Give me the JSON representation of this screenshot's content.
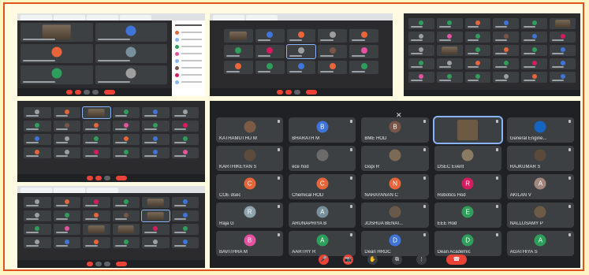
{
  "big_call": {
    "close_glyph": "✕",
    "participants": [
      {
        "label": "KATHAMUTHU M",
        "initial": "",
        "color": "#7b5b43",
        "photo": true
      },
      {
        "label": "BHARATH M",
        "initial": "B",
        "color": "#3f74d8",
        "photo": false
      },
      {
        "label": "BME HOD",
        "initial": "B",
        "color": "#795548",
        "photo": false
      },
      {
        "label": "",
        "initial": "",
        "color": "#6d5a45",
        "photo": true,
        "active": true
      },
      {
        "label": "General Engine...",
        "initial": "",
        "color": "#1565c0",
        "photo": true
      },
      {
        "label": "KARTHIKEYAN S",
        "initial": "",
        "color": "#5d4c3c",
        "photo": true
      },
      {
        "label": "ece hod",
        "initial": "",
        "color": "#6b6b6b",
        "photo": true
      },
      {
        "label": "Gopi R",
        "initial": "",
        "color": "#7c6a55",
        "photo": true
      },
      {
        "label": "DSEC Event",
        "initial": "",
        "color": "#8c7b63",
        "photo": true
      },
      {
        "label": "RAJKUMAR S",
        "initial": "",
        "color": "#5b4a3a",
        "photo": true
      },
      {
        "label": "COE dsec",
        "initial": "C",
        "color": "#e8653a",
        "photo": false
      },
      {
        "label": "Chemical HOD",
        "initial": "C",
        "color": "#e8653a",
        "photo": false
      },
      {
        "label": "NARAYANAN C",
        "initial": "N",
        "color": "#e8653a",
        "photo": false
      },
      {
        "label": "Robotics Hod",
        "initial": "R",
        "color": "#d81b60",
        "photo": false
      },
      {
        "label": "AKILAN V",
        "initial": "A",
        "color": "#a1887f",
        "photo": false
      },
      {
        "label": "Raja G",
        "initial": "R",
        "color": "#90a4ae",
        "photo": false
      },
      {
        "label": "ARUNAPRIYA B",
        "initial": "A",
        "color": "#78909c",
        "photo": false
      },
      {
        "label": "JOSHUA BENAI...",
        "initial": "",
        "color": "#6a5848",
        "photo": true
      },
      {
        "label": "EEE Hod",
        "initial": "E",
        "color": "#2e9e5b",
        "photo": false
      },
      {
        "label": "NALLUSAMY P",
        "initial": "",
        "color": "#6f5a46",
        "photo": true
      },
      {
        "label": "BAVITHRA M",
        "initial": "B",
        "color": "#e552a0",
        "photo": false
      },
      {
        "label": "AARTHY R",
        "initial": "A",
        "color": "#2e9e5b",
        "photo": false
      },
      {
        "label": "Dean HRDC",
        "initial": "D",
        "color": "#3f74d8",
        "photo": false
      },
      {
        "label": "Dean Academic",
        "initial": "D",
        "color": "#2e9e5b",
        "photo": false
      },
      {
        "label": "AGATHIYA S",
        "initial": "A",
        "color": "#2e9e5b",
        "photo": false
      }
    ],
    "controls": [
      "🎤",
      "📷",
      "✋",
      "⧉",
      "⋮"
    ],
    "end_glyph": "☎"
  },
  "colors": {
    "frame": "#e0531f",
    "background": "#fdf5c4",
    "call_bg": "#202124",
    "tile": "#3c4043",
    "end": "#ea4335"
  }
}
